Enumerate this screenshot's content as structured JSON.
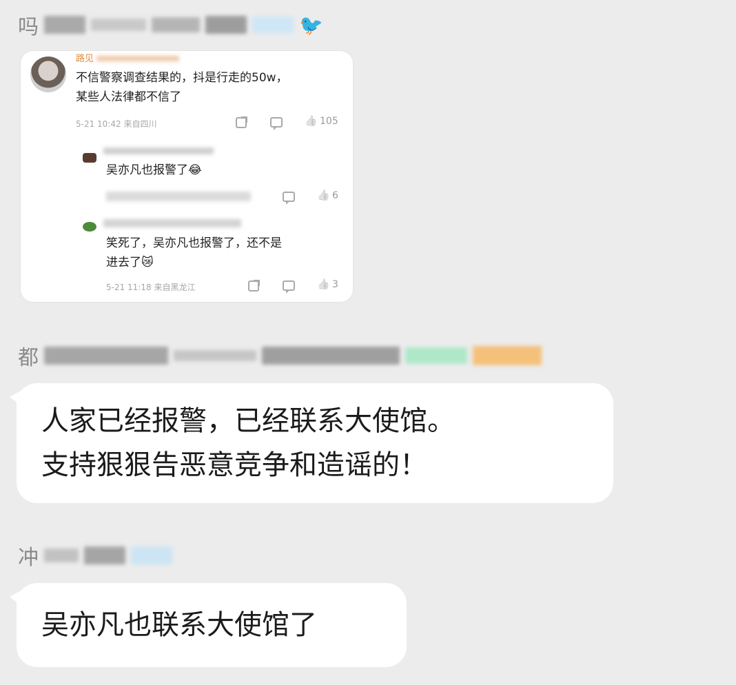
{
  "messages": [
    {
      "sender_prefix": "吗",
      "embedded_card": {
        "comment_author": "路见",
        "comment_line1": "不信警察调查结果的，抖是行走的50w，",
        "comment_line2": "某些人法律都不信了",
        "comment_meta": "5-21 10:42 来自四川",
        "comment_likes": "105",
        "reply1_text": "吴亦凡也报警了😂",
        "reply1_likes": "6",
        "reply2_line1": "笑死了，吴亦凡也报警了，还不是",
        "reply2_line2": "进去了😿",
        "reply2_meta": "5-21 11:18 来自黑龙江",
        "reply2_likes": "3"
      }
    },
    {
      "sender_prefix": "都",
      "line1": "人家已经报警，已经联系大使馆。",
      "line2": "支持狠狠告恶意竞争和造谣的！"
    },
    {
      "sender_prefix": "冲",
      "line1": "吴亦凡也联系大使馆了"
    }
  ],
  "colors": {
    "background": "#ececec",
    "bubble": "#ffffff",
    "sender_text": "#8a8a8a"
  }
}
